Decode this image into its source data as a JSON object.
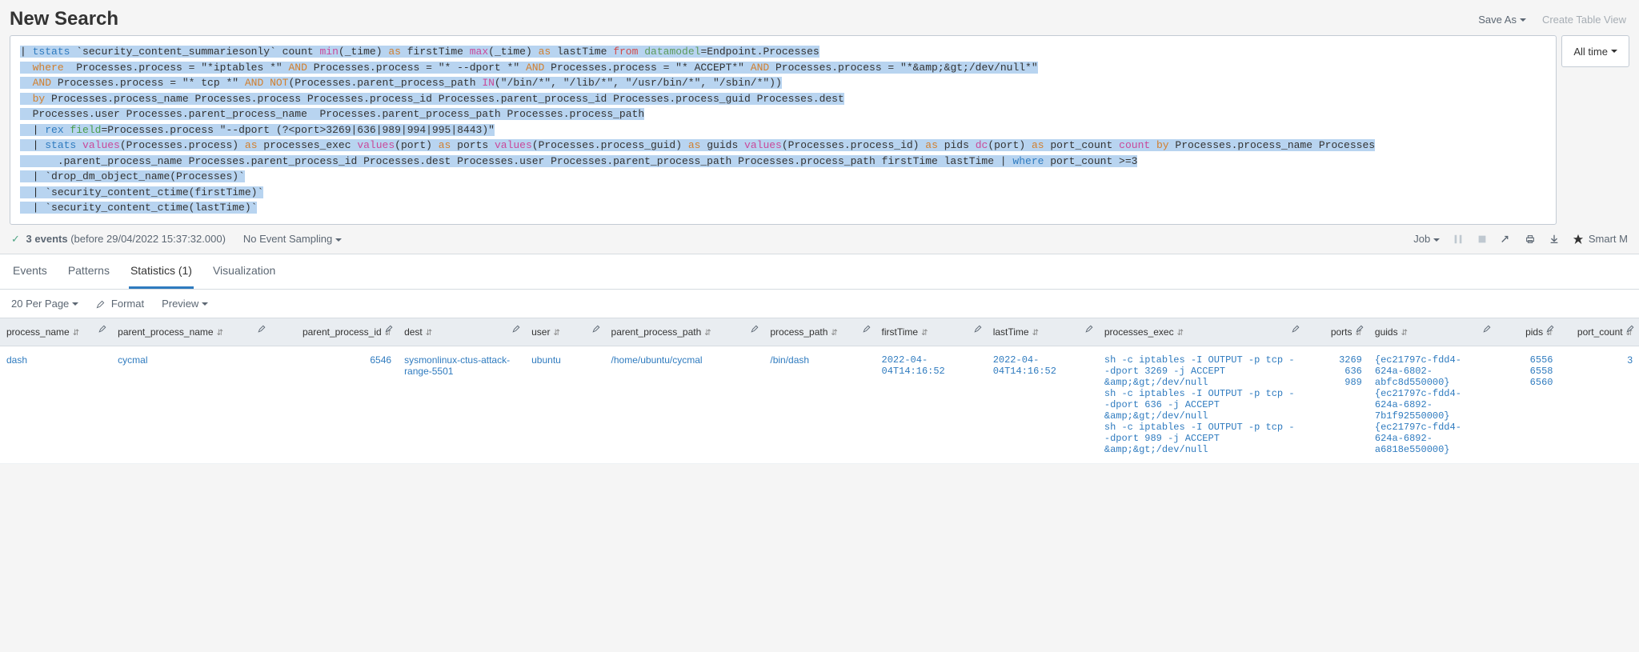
{
  "header": {
    "title": "New Search",
    "save_as": "Save As",
    "create_table_view": "Create Table View"
  },
  "search": {
    "time_picker": "All time",
    "spl_tokens": [
      [
        {
          "c": "t-pipe",
          "t": "| "
        },
        {
          "c": "t-cmd",
          "t": "tstats"
        },
        {
          "c": "",
          "t": " "
        },
        {
          "c": "t-macro",
          "t": "`security_content_summariesonly`"
        },
        {
          "c": "",
          "t": " count "
        },
        {
          "c": "t-func",
          "t": "min"
        },
        {
          "c": "",
          "t": "(_time) "
        },
        {
          "c": "t-as",
          "t": "as"
        },
        {
          "c": "",
          "t": " firstTime "
        },
        {
          "c": "t-func",
          "t": "max"
        },
        {
          "c": "",
          "t": "(_time) "
        },
        {
          "c": "t-as",
          "t": "as"
        },
        {
          "c": "",
          "t": " lastTime "
        },
        {
          "c": "t-from",
          "t": "from"
        },
        {
          "c": "",
          "t": " "
        },
        {
          "c": "t-dm",
          "t": "datamodel"
        },
        {
          "c": "",
          "t": "=Endpoint.Processes"
        }
      ],
      [
        {
          "c": "t-kw",
          "t": "  where"
        },
        {
          "c": "",
          "t": "  Processes.process = \"*iptables *\" "
        },
        {
          "c": "t-bool",
          "t": "AND"
        },
        {
          "c": "",
          "t": " Processes.process = \"* --dport *\" "
        },
        {
          "c": "t-bool",
          "t": "AND"
        },
        {
          "c": "",
          "t": " Processes.process = \"* ACCEPT*\" "
        },
        {
          "c": "t-bool",
          "t": "AND"
        },
        {
          "c": "",
          "t": " Processes.process = \"*&amp;&gt;/dev/null*\""
        }
      ],
      [
        {
          "c": "t-bool",
          "t": "  AND"
        },
        {
          "c": "",
          "t": " Processes.process = \"* tcp *\" "
        },
        {
          "c": "t-bool",
          "t": "AND NOT"
        },
        {
          "c": "",
          "t": "(Processes.parent_process_path "
        },
        {
          "c": "t-func",
          "t": "IN"
        },
        {
          "c": "",
          "t": "(\"/bin/*\", \"/lib/*\", \"/usr/bin/*\", \"/sbin/*\"))"
        }
      ],
      [
        {
          "c": "t-kw",
          "t": "  by"
        },
        {
          "c": "",
          "t": " Processes.process_name Processes.process Processes.process_id Processes.parent_process_id Processes.process_guid Processes.dest"
        }
      ],
      [
        {
          "c": "",
          "t": "  Processes.user Processes.parent_process_name  Processes.parent_process_path Processes.process_path"
        }
      ],
      [
        {
          "c": "t-pipe",
          "t": "  | "
        },
        {
          "c": "t-cmd",
          "t": "rex"
        },
        {
          "c": "",
          "t": " "
        },
        {
          "c": "t-field",
          "t": "field"
        },
        {
          "c": "",
          "t": "=Processes.process \"--dport (?<port>3269|636|989|994|995|8443)\""
        }
      ],
      [
        {
          "c": "t-pipe",
          "t": "  | "
        },
        {
          "c": "t-cmd",
          "t": "stats"
        },
        {
          "c": "",
          "t": " "
        },
        {
          "c": "t-func",
          "t": "values"
        },
        {
          "c": "",
          "t": "(Processes.process) "
        },
        {
          "c": "t-as",
          "t": "as"
        },
        {
          "c": "",
          "t": " processes_exec "
        },
        {
          "c": "t-func",
          "t": "values"
        },
        {
          "c": "",
          "t": "(port) "
        },
        {
          "c": "t-as",
          "t": "as"
        },
        {
          "c": "",
          "t": " ports "
        },
        {
          "c": "t-func",
          "t": "values"
        },
        {
          "c": "",
          "t": "(Processes.process_guid) "
        },
        {
          "c": "t-as",
          "t": "as"
        },
        {
          "c": "",
          "t": " guids "
        },
        {
          "c": "t-func",
          "t": "values"
        },
        {
          "c": "",
          "t": "(Processes.process_id) "
        },
        {
          "c": "t-as",
          "t": "as"
        },
        {
          "c": "",
          "t": " pids "
        },
        {
          "c": "t-func",
          "t": "dc"
        },
        {
          "c": "",
          "t": "(port) "
        },
        {
          "c": "t-as",
          "t": "as"
        },
        {
          "c": "",
          "t": " port_count "
        },
        {
          "c": "t-func",
          "t": "count"
        },
        {
          "c": "",
          "t": " "
        },
        {
          "c": "t-kw",
          "t": "by"
        },
        {
          "c": "",
          "t": " Processes.process_name Processes"
        }
      ],
      [
        {
          "c": "",
          "t": "      .parent_process_name Processes.parent_process_id Processes.dest Processes.user Processes.parent_process_path Processes.process_path firstTime lastTime | "
        },
        {
          "c": "t-cmd",
          "t": "where"
        },
        {
          "c": "",
          "t": " port_count >=3"
        }
      ],
      [
        {
          "c": "t-pipe",
          "t": "  | "
        },
        {
          "c": "t-macro",
          "t": "`drop_dm_object_name(Processes)`"
        }
      ],
      [
        {
          "c": "t-pipe",
          "t": "  | "
        },
        {
          "c": "t-macro",
          "t": "`security_content_ctime(firstTime)`"
        }
      ],
      [
        {
          "c": "t-pipe",
          "t": "  | "
        },
        {
          "c": "t-macro",
          "t": "`security_content_ctime(lastTime)`"
        }
      ]
    ]
  },
  "status": {
    "events_line_prefix": "3 events",
    "events_line_suffix": " (before 29/04/2022 15:37:32.000)",
    "sampling": "No Event Sampling",
    "job": "Job",
    "smart_mode": "Smart M"
  },
  "tabs": {
    "events": "Events",
    "patterns": "Patterns",
    "statistics": "Statistics (1)",
    "visualization": "Visualization"
  },
  "toolbar": {
    "per_page": "20 Per Page",
    "format": "Format",
    "preview": "Preview"
  },
  "columns": [
    {
      "key": "process_name",
      "label": "process_name",
      "align": "left",
      "w": "7%"
    },
    {
      "key": "parent_process_name",
      "label": "parent_process_name",
      "align": "left",
      "w": "10%"
    },
    {
      "key": "parent_process_id",
      "label": "parent_process_id",
      "align": "right",
      "w": "8%"
    },
    {
      "key": "dest",
      "label": "dest",
      "align": "left",
      "w": "8%"
    },
    {
      "key": "user",
      "label": "user",
      "align": "left",
      "w": "5%"
    },
    {
      "key": "parent_process_path",
      "label": "parent_process_path",
      "align": "left",
      "w": "10%"
    },
    {
      "key": "process_path",
      "label": "process_path",
      "align": "left",
      "w": "7%"
    },
    {
      "key": "firstTime",
      "label": "firstTime",
      "align": "left",
      "w": "7%"
    },
    {
      "key": "lastTime",
      "label": "lastTime",
      "align": "left",
      "w": "7%"
    },
    {
      "key": "processes_exec",
      "label": "processes_exec",
      "align": "left",
      "w": "13%"
    },
    {
      "key": "ports",
      "label": "ports",
      "align": "right",
      "w": "4%"
    },
    {
      "key": "guids",
      "label": "guids",
      "align": "left",
      "w": "8%"
    },
    {
      "key": "pids",
      "label": "pids",
      "align": "right",
      "w": "4%"
    },
    {
      "key": "port_count",
      "label": "port_count",
      "align": "right",
      "w": "5%"
    }
  ],
  "rows": [
    {
      "process_name": "dash",
      "parent_process_name": "cycmal",
      "parent_process_id": "6546",
      "dest": "sysmonlinux-ctus-attack-range-5501",
      "user": "ubuntu",
      "parent_process_path": "/home/ubuntu/cycmal",
      "process_path": "/bin/dash",
      "firstTime": "2022-04-04T14:16:52",
      "lastTime": "2022-04-04T14:16:52",
      "processes_exec": [
        "sh -c iptables -I OUTPUT -p tcp --dport 3269 -j ACCEPT &amp;&gt;/dev/null",
        "sh -c iptables -I OUTPUT -p tcp --dport 636 -j ACCEPT &amp;&gt;/dev/null",
        "sh -c iptables -I OUTPUT -p tcp --dport 989 -j ACCEPT &amp;&gt;/dev/null"
      ],
      "ports": [
        "3269",
        "636",
        "989"
      ],
      "guids": [
        "{ec21797c-fdd4-624a-6802-abfc8d550000}",
        "{ec21797c-fdd4-624a-6892-7b1f92550000}",
        "{ec21797c-fdd4-624a-6892-a6818e550000}"
      ],
      "pids": [
        "6556",
        "6558",
        "6560"
      ],
      "port_count": "3"
    }
  ]
}
